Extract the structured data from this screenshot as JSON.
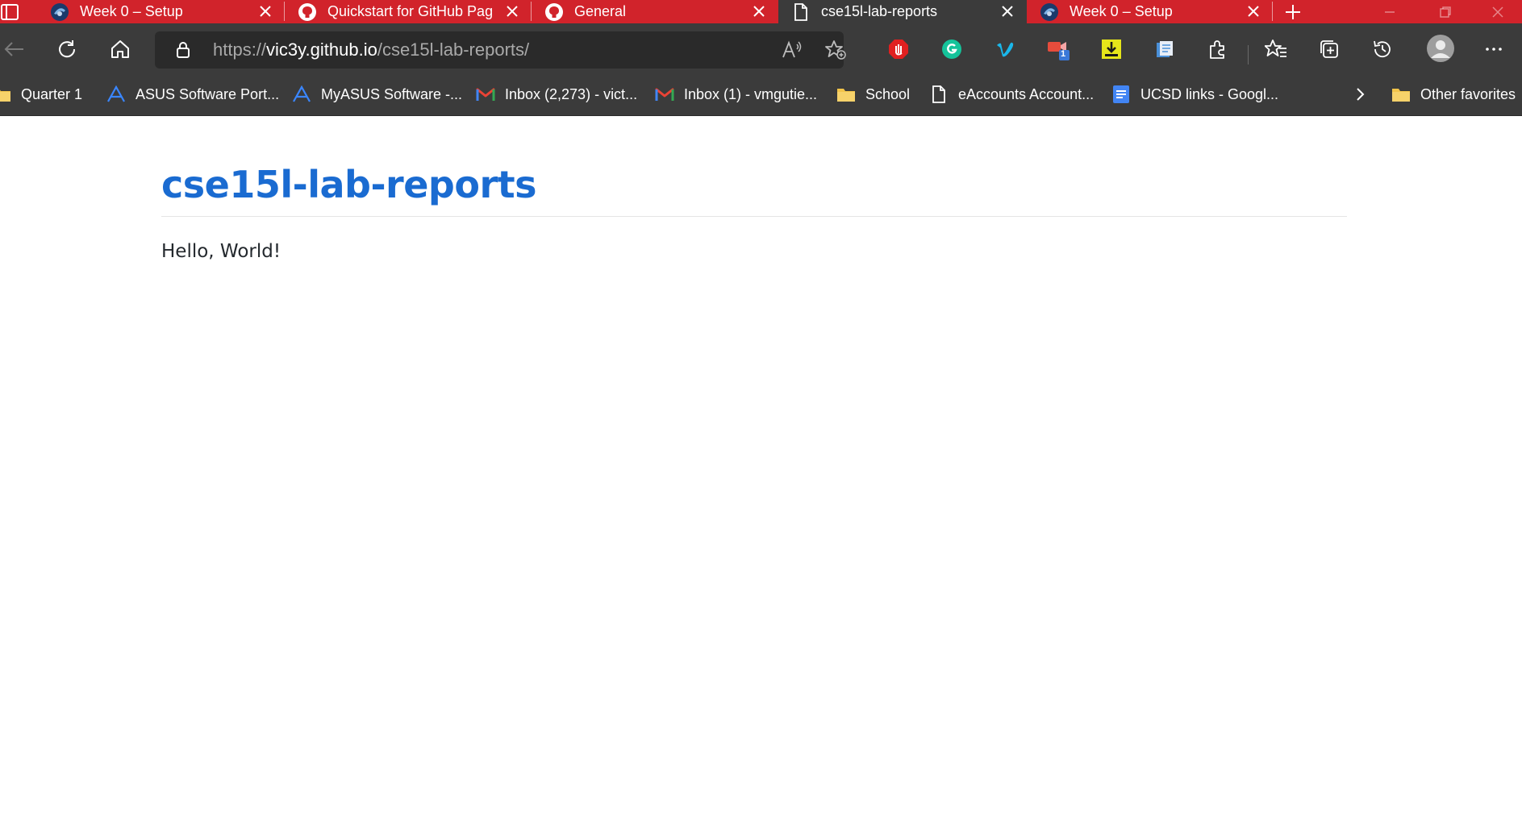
{
  "browser": {
    "tabs": [
      {
        "title": "Week 0 – Setup",
        "favicon": "ucsd-triton-icon",
        "active": false
      },
      {
        "title": "Quickstart for GitHub Pag",
        "favicon": "github-icon",
        "active": false
      },
      {
        "title": "General",
        "favicon": "github-icon",
        "active": false
      },
      {
        "title": "cse15l-lab-reports",
        "favicon": "page-icon",
        "active": true
      },
      {
        "title": "Week 0 – Setup",
        "favicon": "ucsd-triton-icon",
        "active": false
      }
    ],
    "address": {
      "scheme": "https://",
      "host": "vic3y.github.io",
      "path": "/cse15l-lab-reports/"
    },
    "extension_badge": "1",
    "favorites": [
      {
        "label": "Quarter 1",
        "icon": "folder-icon"
      },
      {
        "label": "ASUS Software Port...",
        "icon": "asus-icon"
      },
      {
        "label": "MyASUS Software -...",
        "icon": "asus-icon"
      },
      {
        "label": "Inbox (2,273) - vict...",
        "icon": "gmail-icon"
      },
      {
        "label": "Inbox (1) - vmgutie...",
        "icon": "gmail-icon"
      },
      {
        "label": "School",
        "icon": "folder-icon"
      },
      {
        "label": "eAccounts Account...",
        "icon": "page-icon"
      },
      {
        "label": "UCSD links - Googl...",
        "icon": "google-docs-icon"
      }
    ],
    "other_favorites": "Other favorites",
    "colors": {
      "frame": "#d1232b",
      "toolbar": "#3b3b3b",
      "omnibox": "#2a2a2a"
    }
  },
  "page": {
    "title": "cse15l-lab-reports",
    "body": "Hello, World!",
    "colors": {
      "title": "#1a6bd1",
      "text": "#24292e"
    }
  }
}
